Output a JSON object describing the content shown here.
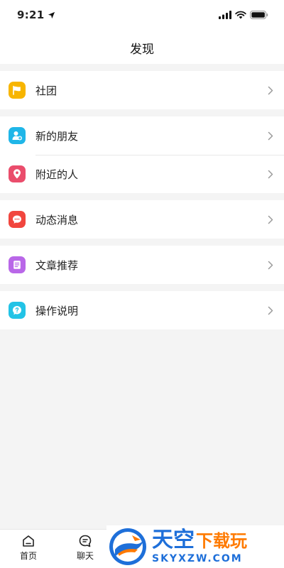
{
  "status_bar": {
    "time": "9:21",
    "icons": [
      "location-arrow-icon",
      "signal-icon",
      "wifi-icon",
      "battery-icon"
    ]
  },
  "nav": {
    "title": "发现"
  },
  "groups": [
    {
      "items": [
        {
          "label": "社团",
          "icon": "flag-icon",
          "color": "#f7b500"
        }
      ]
    },
    {
      "items": [
        {
          "label": "新的朋友",
          "icon": "add-friend-icon",
          "color": "#1fb6e8"
        },
        {
          "label": "附近的人",
          "icon": "location-pin-icon",
          "color": "#ea4d6c"
        }
      ]
    },
    {
      "items": [
        {
          "label": "动态消息",
          "icon": "message-icon",
          "color": "#f1463e"
        }
      ]
    },
    {
      "items": [
        {
          "label": "文章推荐",
          "icon": "document-icon",
          "color": "#b967e8"
        }
      ]
    },
    {
      "items": [
        {
          "label": "操作说明",
          "icon": "help-icon",
          "color": "#22c3e6"
        }
      ]
    }
  ],
  "tab_bar": {
    "tabs": [
      {
        "label": "首页",
        "icon": "home-icon"
      },
      {
        "label": "聊天",
        "icon": "chat-icon"
      }
    ]
  },
  "watermark": {
    "title_a": "天空",
    "title_b": "下载玩",
    "subtitle": "SKYXZW.COM"
  }
}
